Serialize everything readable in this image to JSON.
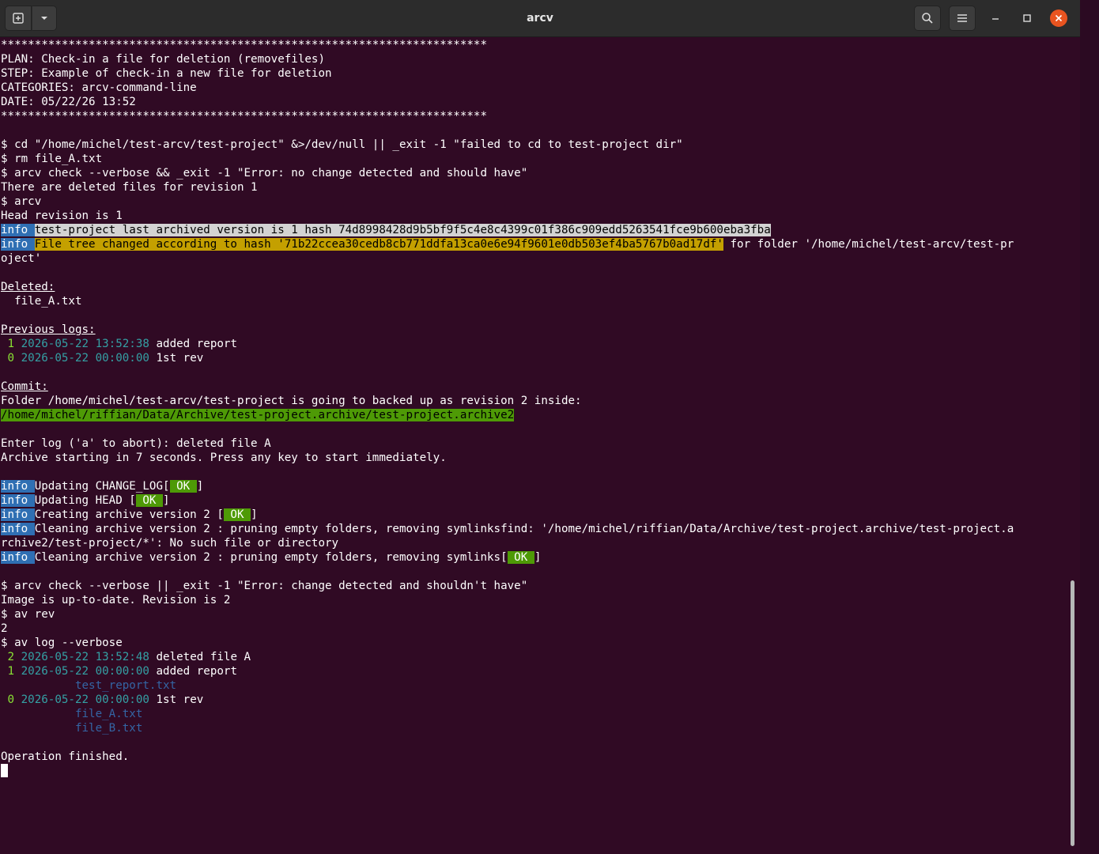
{
  "window": {
    "title": "arcv"
  },
  "icons": {
    "new_tab": "new-tab-icon",
    "dropdown": "chevron-down-icon",
    "search": "search-icon",
    "menu": "hamburger-menu-icon",
    "minimize": "minimize-icon",
    "maximize": "maximize-icon",
    "close": "close-icon"
  },
  "colors": {
    "background": "#300a24",
    "info_badge": "#2f6fb3",
    "ok_badge": "#4e9a06",
    "hash_highlight": "#c4a000",
    "close_button": "#e95420"
  },
  "terminal": {
    "l01": "************************************************************************",
    "l02": "PLAN: Check-in a file for deletion (removefiles)",
    "l03": "STEP: Example of check-in a new file for deletion",
    "l04": "CATEGORIES: arcv-command-line",
    "l05": "DATE: 05/22/26 13:52",
    "l06": "************************************************************************",
    "l08": "$ cd \"/home/michel/test-arcv/test-project\" &>/dev/null || _exit -1 \"failed to cd to test-project dir\"",
    "l09": "$ rm file_A.txt",
    "l10": "$ arcv check --verbose && _exit -1 \"Error: no change detected and should have\"",
    "l11": "There are deleted files for revision 1",
    "l12": "$ arcv",
    "l13": "Head revision is 1",
    "info": "info",
    "info_pad": "info ",
    "l14_msg": "test-project last archived version is 1 hash 74d8998428d9b5bf9f5c4e8c4399c01f386c909edd5263541fce9b600eba3fba",
    "l15_msg": "File tree changed according to hash '71b22ccea30cedb8cb771ddfa13ca0e6e94f9601e0db503ef4ba5767b0ad17df'",
    "l15_tail": " for folder '/home/michel/test-arcv/test-pr",
    "l16": "oject'",
    "deleted_label": "Deleted:",
    "deleted_file": "  file_A.txt",
    "prev_logs_label": "Previous logs:",
    "prev_logs": [
      {
        "rev": " 1",
        "date": "2026-05-22 13:52:38",
        "msg": "added report"
      },
      {
        "rev": " 0",
        "date": "2026-05-22 00:00:00",
        "msg": "1st rev"
      }
    ],
    "commit_label": "Commit:",
    "commit_line": "Folder /home/michel/test-arcv/test-project is going to backed up as revision 2 inside:",
    "archive_path": "/home/michel/riffian/Data/Archive/test-project.archive/test-project.archive2",
    "enter_log": "Enter log ('a' to abort): deleted file A",
    "archive_start": "Archive starting in 7 seconds. Press any key to start immediately.",
    "step1": "Updating CHANGE_LOG[",
    "step2": "Updating HEAD [",
    "step3": "Creating archive version 2 [",
    "step4": "Cleaning archive version 2 : pruning empty folders, removing symlinksfind: '/home/michel/riffian/Data/Archive/test-project.archive/test-project.a",
    "step4b": "rchive2/test-project/*': No such file or directory",
    "step5": "Cleaning archive version 2 : pruning empty folders, removing symlinks[",
    "ok": " OK ",
    "close_bracket": "]",
    "l_check2": "$ arcv check --verbose || _exit -1 \"Error: change detected and shouldn't have\"",
    "l_uptodate": "Image is up-to-date. Revision is 2",
    "l_avrev": "$ av rev",
    "l_rev": "2",
    "l_avlog": "$ av log --verbose",
    "log_entries": [
      {
        "rev": " 2",
        "date": "2026-05-22 13:52:48",
        "msg": "deleted file A"
      },
      {
        "rev": " 1",
        "date": "2026-05-22 00:00:00",
        "msg": "added report"
      },
      {
        "rev": " 0",
        "date": "2026-05-22 00:00:00",
        "msg": "1st rev"
      }
    ],
    "log_file_report": "           test_report.txt",
    "log_file_a": "           file_A.txt",
    "log_file_b": "           file_B.txt",
    "finished": "Operation finished."
  }
}
